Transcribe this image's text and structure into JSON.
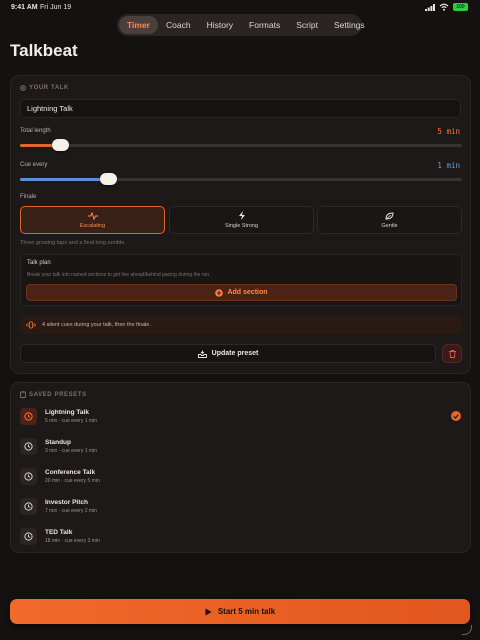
{
  "status": {
    "time": "9:41 AM",
    "date": "Fri Jun 19",
    "battery": "100"
  },
  "nav": {
    "tabs": [
      "Timer",
      "Coach",
      "History",
      "Formats",
      "Script",
      "Settings"
    ],
    "active": "Timer"
  },
  "app_title": "Talkbeat",
  "your_talk": {
    "section_label": "YOUR TALK",
    "name": "Lightning Talk",
    "total_length": {
      "label": "Total length",
      "value": "5 min",
      "fraction": 0.09
    },
    "cue_every": {
      "label": "Cue every",
      "value": "1 min",
      "fraction": 0.2
    },
    "finale": {
      "label": "Finale",
      "options": [
        "Escalating",
        "Single Strong",
        "Gentle"
      ],
      "selected": "Escalating",
      "hint": "Three growing taps and a final long rumble."
    },
    "talk_plan": {
      "title": "Talk plan",
      "description": "Break your talk into named sections to get live ahead/behind pacing during the run.",
      "add_label": "Add section"
    },
    "cue_summary": "4 silent cues during your talk, then the finale.",
    "update_label": "Update preset"
  },
  "saved_presets": {
    "section_label": "SAVED PRESETS",
    "items": [
      {
        "name": "Lightning Talk",
        "meta": "5 min · cue every 1 min",
        "active": true
      },
      {
        "name": "Standup",
        "meta": "3 min · cue every 1 min",
        "active": false
      },
      {
        "name": "Conference Talk",
        "meta": "20 min · cue every 5 min",
        "active": false
      },
      {
        "name": "Investor Pitch",
        "meta": "7 min · cue every 2 min",
        "active": false
      },
      {
        "name": "TED Talk",
        "meta": "18 min · cue every 3 min",
        "active": false
      }
    ]
  },
  "start_label": "Start 5 min talk",
  "colors": {
    "accent": "#e0662b",
    "cue_blue": "#5b8fd6",
    "background": "#141110"
  }
}
